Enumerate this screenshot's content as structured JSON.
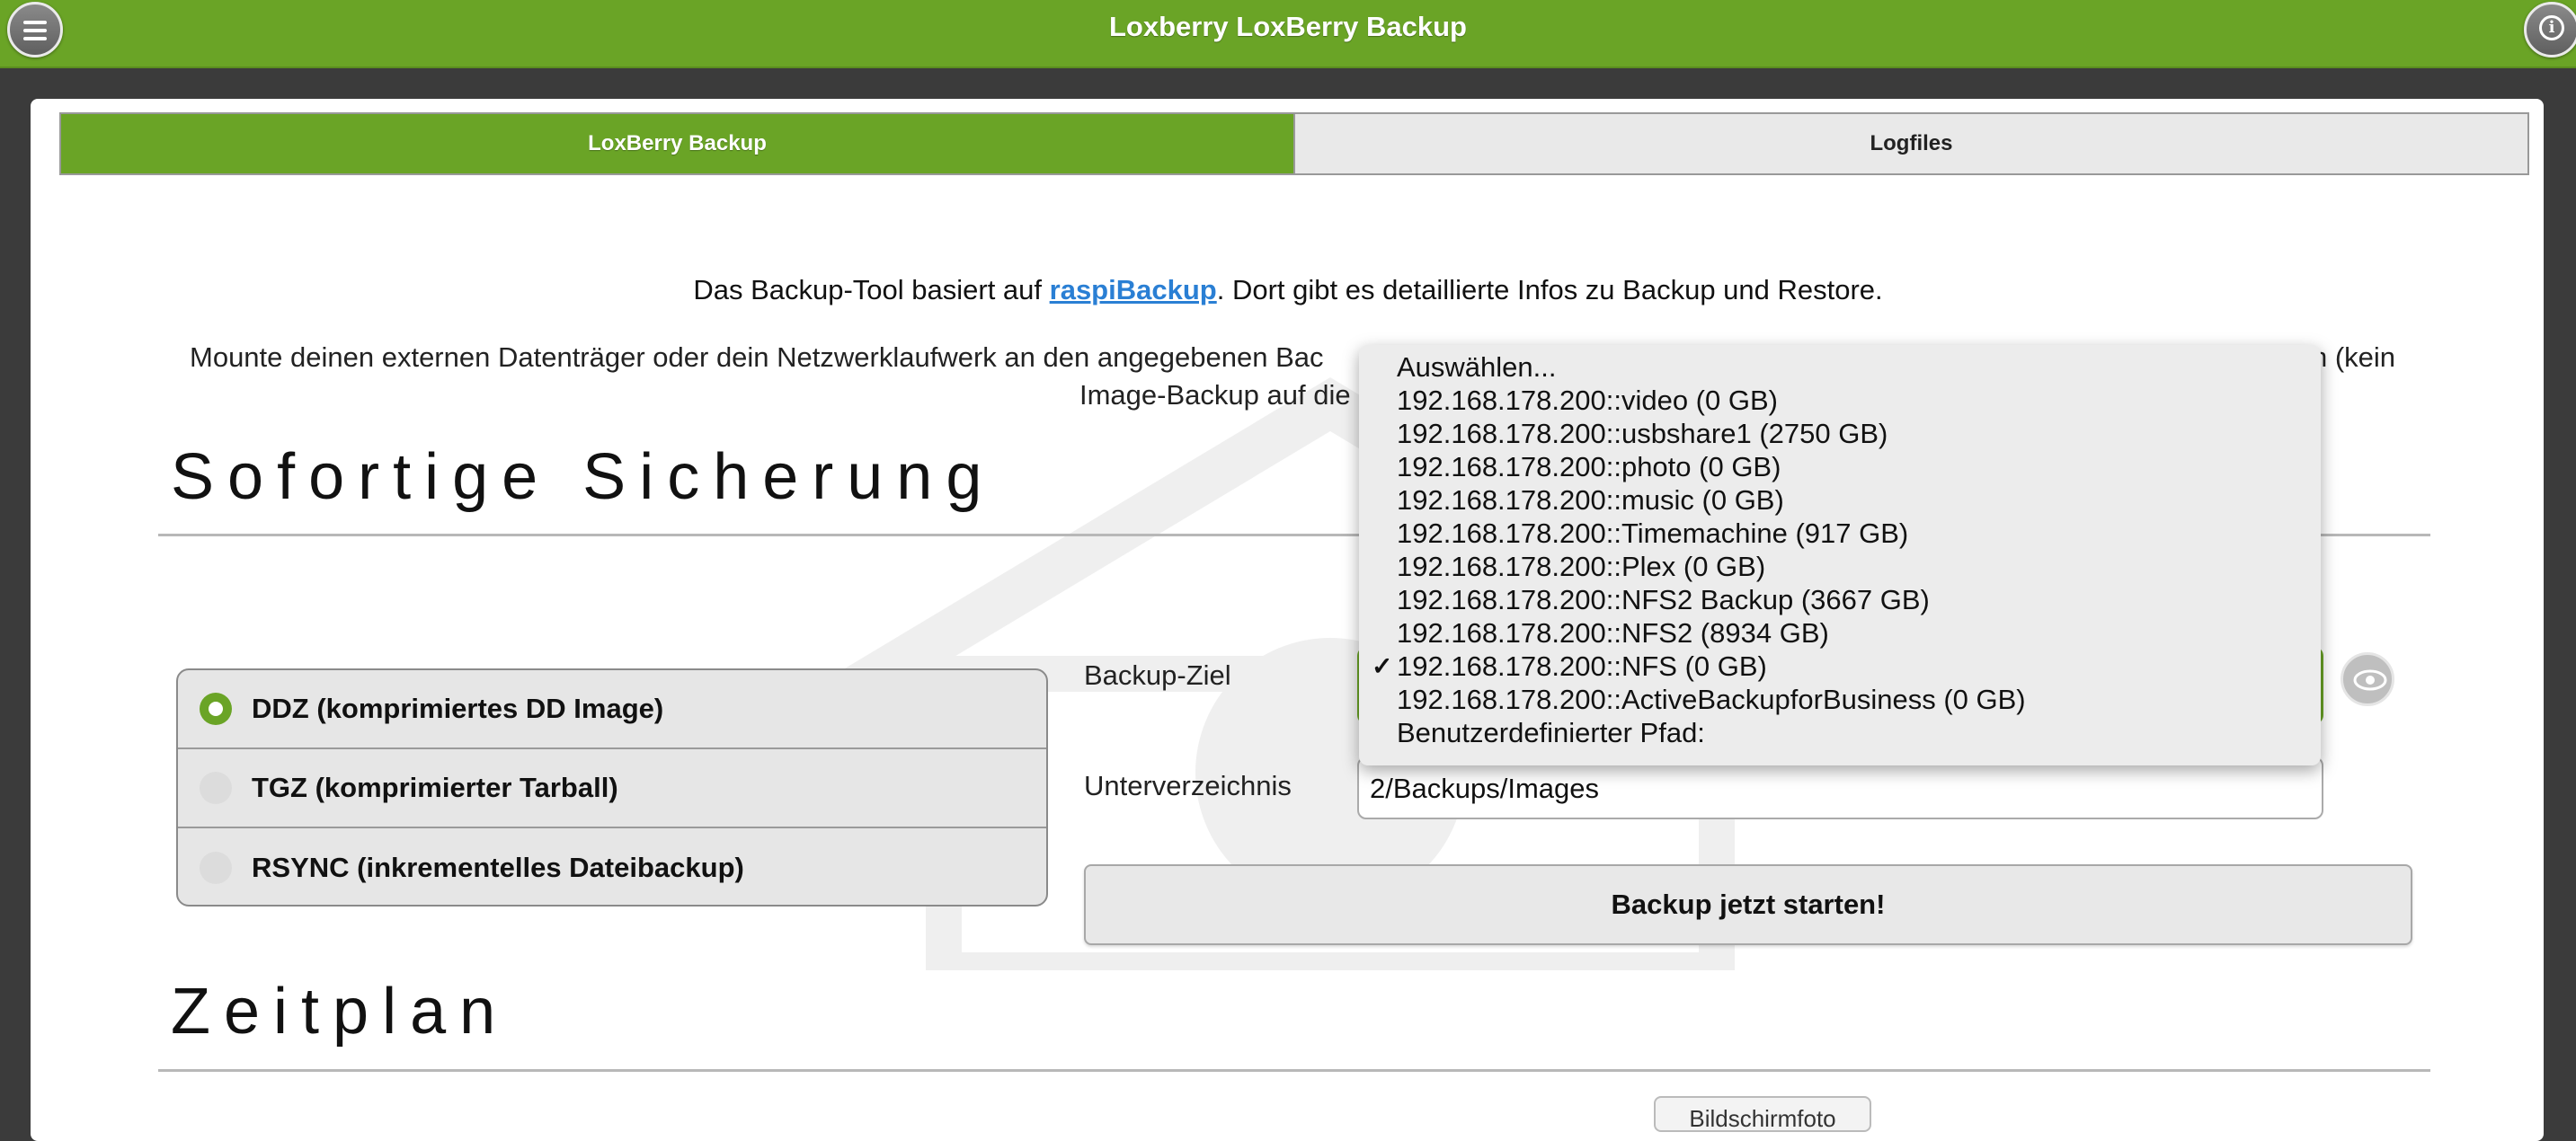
{
  "header": {
    "title": "Loxberry LoxBerry Backup",
    "menu_icon": "menu-icon",
    "info_icon": "info-icon"
  },
  "tabs": [
    {
      "label": "LoxBerry Backup",
      "active": true
    },
    {
      "label": "Logfiles",
      "active": false
    }
  ],
  "intro": {
    "line1_prefix": "Das Backup-Tool basiert auf ",
    "line1_link": "raspiBackup",
    "line1_suffix": ". Dort gibt es detaillierte Infos zu Backup und Restore.",
    "line2_left": "Mounte deinen externen Datenträger oder dein Netzwerklaufwerk an den angegebenen Bac",
    "line2_right": "n (kein",
    "line3_left": "Image-Backup auf die"
  },
  "sections": {
    "immediate": "Sofortige Sicherung",
    "schedule": "Zeitplan"
  },
  "backup_types": [
    {
      "label": "DDZ (komprimiertes DD Image)",
      "selected": true
    },
    {
      "label": "TGZ (komprimierter Tarball)",
      "selected": false
    },
    {
      "label": "RSYNC (inkrementelles Dateibackup)",
      "selected": false
    }
  ],
  "form": {
    "target_label": "Backup-Ziel",
    "subdir_label": "Unterverzeichnis",
    "subdir_value": "2/Backups/Images",
    "start_button": "Backup jetzt starten!",
    "eye_icon": "eye-icon"
  },
  "dropdown": {
    "options": [
      {
        "label": "Auswählen...",
        "checked": false
      },
      {
        "label": "192.168.178.200::video (0 GB)",
        "checked": false
      },
      {
        "label": "192.168.178.200::usbshare1 (2750 GB)",
        "checked": false
      },
      {
        "label": "192.168.178.200::photo (0 GB)",
        "checked": false
      },
      {
        "label": "192.168.178.200::music (0 GB)",
        "checked": false
      },
      {
        "label": "192.168.178.200::Timemachine (917 GB)",
        "checked": false
      },
      {
        "label": "192.168.178.200::Plex (0 GB)",
        "checked": false
      },
      {
        "label": "192.168.178.200::NFS2 Backup (3667 GB)",
        "checked": false
      },
      {
        "label": "192.168.178.200::NFS2 (8934 GB)",
        "checked": false
      },
      {
        "label": "192.168.178.200::NFS (0 GB)",
        "checked": true
      },
      {
        "label": "192.168.178.200::ActiveBackupforBusiness (0 GB)",
        "checked": false
      },
      {
        "label": "Benutzerdefinierter Pfad:",
        "checked": false
      }
    ]
  },
  "misc": {
    "screenshot_button": "Bildschirmfoto"
  },
  "colors": {
    "accent": "#6aa426",
    "link": "#2a7fd4"
  }
}
